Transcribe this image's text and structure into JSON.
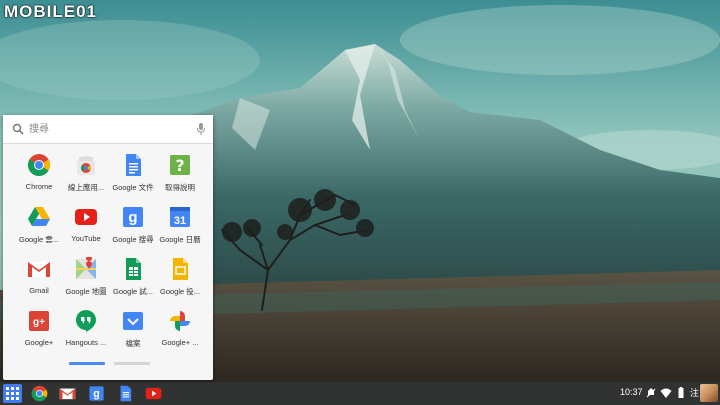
{
  "watermark": {
    "text": "MOBILE01"
  },
  "launcher": {
    "search": {
      "placeholder": "搜尋"
    },
    "apps": [
      {
        "label": "Chrome",
        "icon": "chrome-icon"
      },
      {
        "label": "線上應用...",
        "icon": "web-store-icon"
      },
      {
        "label": "Google 文件",
        "icon": "docs-icon"
      },
      {
        "label": "取得說明",
        "icon": "help-icon"
      },
      {
        "label": "Google 雲...",
        "icon": "drive-icon"
      },
      {
        "label": "YouTube",
        "icon": "youtube-icon"
      },
      {
        "label": "Google 搜尋",
        "icon": "google-search-icon"
      },
      {
        "label": "Google 日曆",
        "icon": "calendar-icon"
      },
      {
        "label": "Gmail",
        "icon": "gmail-icon"
      },
      {
        "label": "Google 地圖",
        "icon": "maps-icon"
      },
      {
        "label": "Google 試...",
        "icon": "sheets-icon"
      },
      {
        "label": "Google 投...",
        "icon": "slides-icon"
      },
      {
        "label": "Google+",
        "icon": "google-plus-icon"
      },
      {
        "label": "Hangouts ...",
        "icon": "hangouts-icon"
      },
      {
        "label": "檔案",
        "icon": "files-icon"
      },
      {
        "label": "Google+ ...",
        "icon": "photos-icon"
      }
    ],
    "calendar_day": "31",
    "google_letter": "g",
    "gplus_letter": "g+",
    "help_glyph": "?",
    "pages": 2,
    "current_page": 1
  },
  "shelf": {
    "pinned": [
      "chrome-icon",
      "gmail-icon",
      "google-search-icon",
      "docs-icon",
      "youtube-icon"
    ],
    "time": "10:37",
    "ime": "注"
  },
  "colors": {
    "accent": "#4a8af4",
    "shelf": "#141616",
    "launcher_bg": "#f6f6f6"
  }
}
